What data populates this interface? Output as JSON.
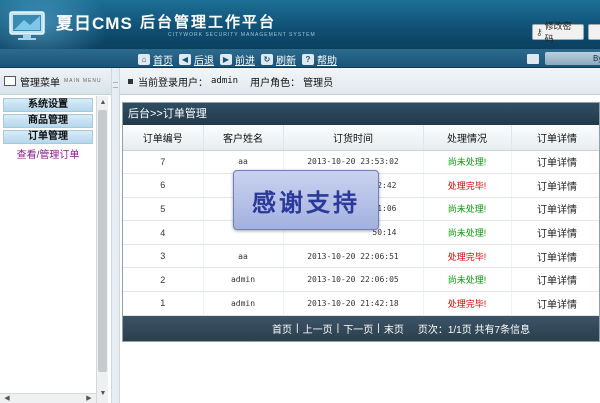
{
  "header": {
    "logo_title": "夏日CMS",
    "logo_sub": "后台管理工作平台",
    "logo_tag": "CITYWORK SECURITY MANAGEMENT SYSTEM",
    "change_pwd": "修改密码",
    "change_pwd_icon": "key-icon",
    "exit_icon": "exit-icon"
  },
  "nav": {
    "items": [
      {
        "label": "首页",
        "icon": "home-icon"
      },
      {
        "label": "后退",
        "icon": "back-arrow-icon"
      },
      {
        "label": "前进",
        "icon": "forward-arrow-icon"
      },
      {
        "label": "刷新",
        "icon": "refresh-icon"
      },
      {
        "label": "帮助",
        "icon": "help-icon"
      }
    ],
    "right_text": "By E"
  },
  "sidebar": {
    "title": "管理菜单",
    "title_en": "MAIN MENU",
    "categories": [
      "系统设置",
      "商品管理",
      "订单管理"
    ],
    "active_link": "查看/管理订单"
  },
  "status": {
    "login_label": "当前登录用户：",
    "login_user": "admin",
    "role_label": "用户角色：",
    "role": "管理员"
  },
  "panel": {
    "breadcrumb": "后台>>订单管理",
    "columns": [
      "订单编号",
      "客户姓名",
      "订货时间",
      "处理情况",
      "订单详情"
    ],
    "rows": [
      {
        "id": "7",
        "name": "aa",
        "time": "2013-10-20 23:53:02",
        "status": "尚未处理!",
        "status_type": "pending",
        "detail": "订单详情"
      },
      {
        "id": "6",
        "name": "",
        "time": "52:42",
        "status": "处理完毕!",
        "status_type": "done",
        "detail": "订单详情"
      },
      {
        "id": "5",
        "name": "",
        "time": "51:06",
        "status": "尚未处理!",
        "status_type": "pending",
        "detail": "订单详情"
      },
      {
        "id": "4",
        "name": "",
        "time": "50:14",
        "status": "尚未处理!",
        "status_type": "pending",
        "detail": "订单详情"
      },
      {
        "id": "3",
        "name": "aa",
        "time": "2013-10-20 22:06:51",
        "status": "处理完毕!",
        "status_type": "done",
        "detail": "订单详情"
      },
      {
        "id": "2",
        "name": "admin",
        "time": "2013-10-20 22:06:05",
        "status": "尚未处理!",
        "status_type": "pending",
        "detail": "订单详情"
      },
      {
        "id": "1",
        "name": "admin",
        "time": "2013-10-20 21:42:18",
        "status": "处理完毕!",
        "status_type": "done",
        "detail": "订单详情"
      }
    ],
    "pager": {
      "first": "首页",
      "prev": "上一页",
      "next": "下一页",
      "last": "末页",
      "info": "页次：1/1页 共有7条信息"
    }
  },
  "overlay": {
    "text": "感谢支持"
  },
  "colors": {
    "header": "#0f4f73",
    "pending": "#0a9a0a",
    "done": "#e00000",
    "panel_title": "#23394a"
  }
}
